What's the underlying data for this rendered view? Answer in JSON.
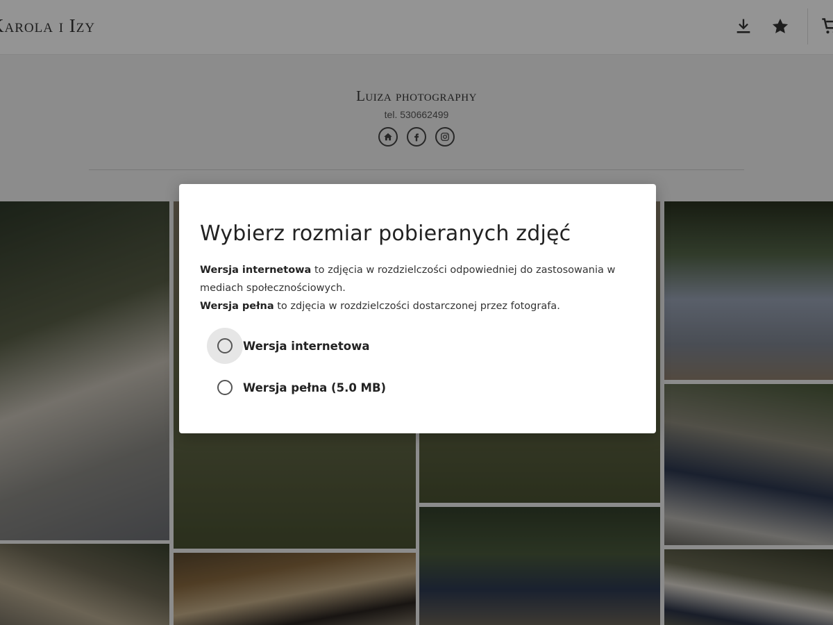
{
  "header": {
    "gallery_title": "Karola i Izy",
    "icons": [
      "download-icon",
      "star-icon",
      "cart-icon"
    ]
  },
  "photographer": {
    "name": "Luiza photography",
    "phone": "tel. 530662499",
    "social_icons": [
      "home-icon",
      "facebook-icon",
      "instagram-icon"
    ]
  },
  "modal": {
    "title": "Wybierz rozmiar pobieranych zdjęć",
    "desc_web_strong": "Wersja internetowa",
    "desc_web_rest": " to zdjęcia w rozdzielczości odpowiedniej do zastosowania w mediach społecznościowych.",
    "desc_full_strong": "Wersja pełna",
    "desc_full_rest": " to zdjęcia w rozdzielczości dostarczonej przez fotografa.",
    "options": [
      {
        "label": "Wersja internetowa",
        "selected": false
      },
      {
        "label": "Wersja pełna (5.0 MB)",
        "selected": false
      }
    ]
  },
  "colors": {
    "overlay": "#000000",
    "modal_bg": "#ffffff",
    "text": "#222222"
  }
}
